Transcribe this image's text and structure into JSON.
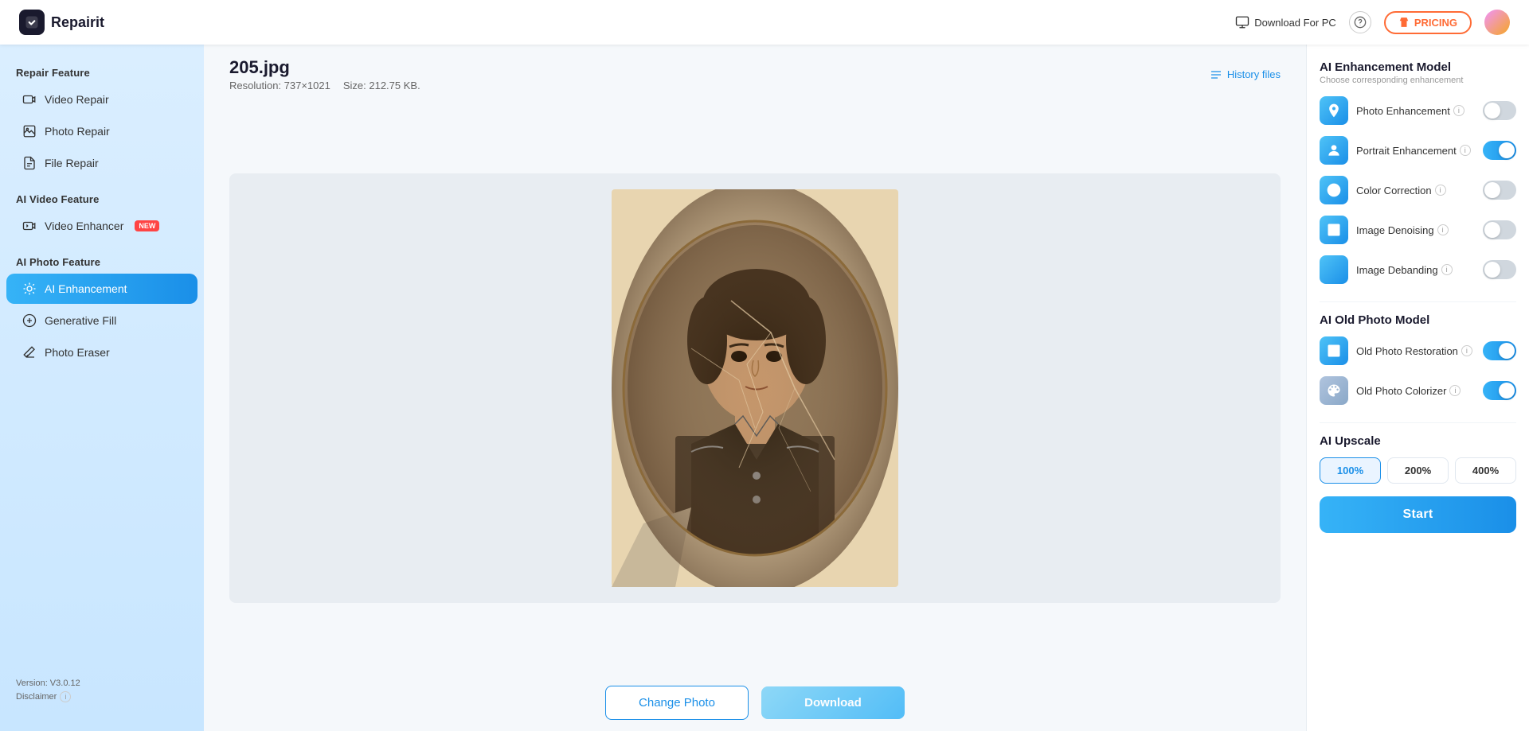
{
  "topbar": {
    "brand": "Repairit",
    "download_pc_label": "Download For PC",
    "pricing_label": "PRICING",
    "avatar_alt": "User Avatar"
  },
  "sidebar": {
    "repair_section": "Repair Feature",
    "video_repair": "Video Repair",
    "photo_repair": "Photo Repair",
    "file_repair": "File Repair",
    "ai_video_section": "AI Video Feature",
    "video_enhancer": "Video Enhancer",
    "video_enhancer_badge": "NEW",
    "ai_photo_section": "AI Photo Feature",
    "ai_enhancement": "AI Enhancement",
    "generative_fill": "Generative Fill",
    "photo_eraser": "Photo Eraser",
    "version": "Version: V3.0.12",
    "disclaimer": "Disclaimer"
  },
  "file_info": {
    "filename": "205.jpg",
    "resolution_label": "Resolution: 737×1021",
    "size_label": "Size: 212.75 KB.",
    "history_label": "History files"
  },
  "right_panel": {
    "enhancement_model_title": "AI Enhancement Model",
    "enhancement_model_subtitle": "Choose corresponding enhancement",
    "enhancements": [
      {
        "id": "photo-enhancement",
        "name": "Photo Enhancement",
        "on": false
      },
      {
        "id": "portrait-enhancement",
        "name": "Portrait Enhancement",
        "on": true
      },
      {
        "id": "color-correction",
        "name": "Color Correction",
        "on": false
      },
      {
        "id": "image-denoising",
        "name": "Image Denoising",
        "on": false
      },
      {
        "id": "image-debanding",
        "name": "Image Debanding",
        "on": false
      }
    ],
    "old_photo_model_title": "AI Old Photo Model",
    "old_photo_items": [
      {
        "id": "old-photo-restoration",
        "name": "Old Photo Restoration",
        "on": true
      },
      {
        "id": "old-photo-colorizer",
        "name": "Old Photo Colorizer",
        "on": true
      }
    ],
    "upscale_title": "AI Upscale",
    "upscale_options": [
      "100%",
      "200%",
      "400%"
    ],
    "upscale_active": "100%",
    "start_label": "Start"
  },
  "actions": {
    "change_photo": "Change Photo",
    "download": "Download"
  }
}
